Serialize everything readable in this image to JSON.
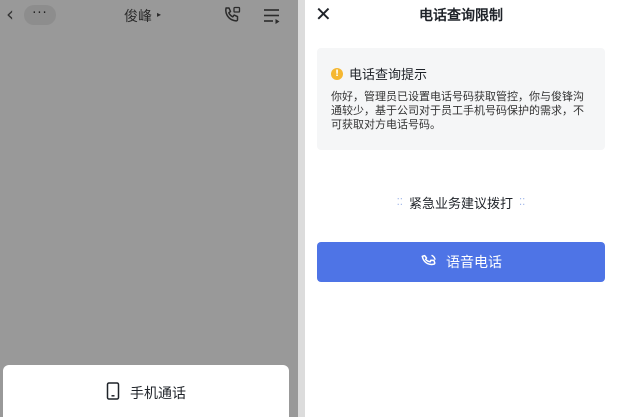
{
  "chat": {
    "back_glyph": "‹",
    "more_glyph": "···",
    "title": "俊峰",
    "title_caret": "▸",
    "icons": {
      "call": "phone-call-icon",
      "menu": "menu-list-icon"
    }
  },
  "sheet": {
    "mobile_call_label": "手机通话",
    "icon": "mobile-phone-icon"
  },
  "dialog": {
    "close_glyph": "✕",
    "title": "电话查询限制",
    "notice": {
      "icon": "warning-icon",
      "title": "电话查询提示",
      "body": "你好，管理员已设置电话号码获取管控，你与俊锋沟通较少，基于公司对于员工手机号码保护的需求，不可获取对方电话号码。"
    },
    "urgent": {
      "left_dots": "⁚⁚",
      "text": "紧急业务建议拨打",
      "right_dots": "⁚⁚"
    },
    "voice_button": {
      "label": "语音电话",
      "icon": "voice-call-icon"
    }
  },
  "colors": {
    "overlay_gray": "#999999",
    "primary_blue": "#4e74e6",
    "warning_yellow": "#f5b731",
    "notice_bg": "#f5f6f7"
  }
}
